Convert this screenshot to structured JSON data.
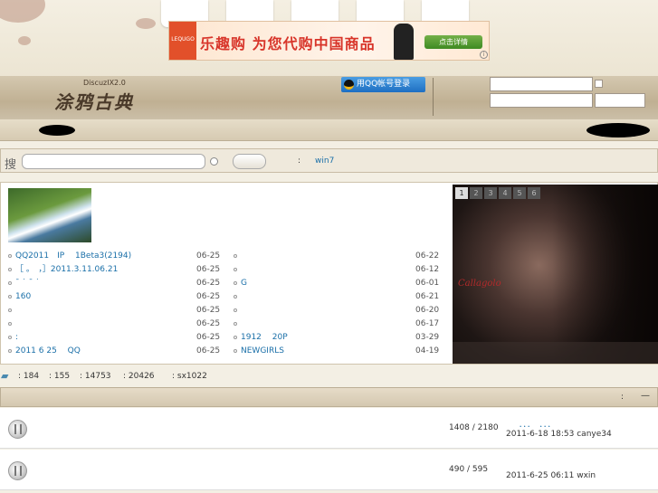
{
  "header": {
    "banner": {
      "brand_small": "LEQUGO",
      "slogan": "乐趣购 为您代购中国商品",
      "cta": "点击详情",
      "info": "i"
    },
    "site_logo": "涂鸦古典",
    "version": "DiscuzIX2.0",
    "qq_login": "用QQ帐号登录"
  },
  "search": {
    "icon": "搜",
    "colon": ":",
    "hot_term": "win7"
  },
  "list": {
    "left": [
      {
        "title": "QQ2011　IP　 1Beta3(2194)",
        "date": "06-25"
      },
      {
        "title": "［ 。　，］2011.3.11.06.21",
        "date": "06-25"
      },
      {
        "title": "ˉ ˙ ˉ ˙",
        "date": "06-25"
      },
      {
        "title": "160",
        "date": "06-25"
      },
      {
        "title": "",
        "date": "06-25"
      },
      {
        "title": "",
        "date": "06-25"
      },
      {
        "title": ":",
        "date": "06-25"
      },
      {
        "title": "2011 6 25　 QQ",
        "date": "06-25"
      }
    ],
    "right": [
      {
        "title": "",
        "date": "06-22"
      },
      {
        "title": "",
        "date": "06-12"
      },
      {
        "title": "G",
        "date": "06-01"
      },
      {
        "title": "",
        "date": "06-21"
      },
      {
        "title": "",
        "date": "06-20"
      },
      {
        "title": "",
        "date": "06-17"
      },
      {
        "title": "1912　 20P",
        "date": "03-29"
      },
      {
        "title": "NEWGIRLS",
        "date": "04-19"
      }
    ]
  },
  "slideshow": {
    "numbers": [
      "1",
      "2",
      "3",
      "4",
      "5",
      "6"
    ],
    "active": 0,
    "signature": "Callagolo"
  },
  "stats": {
    "today": ": 184",
    "yesterday": ": 155",
    "posts": ": 14753",
    "members": ": 20426",
    "newest": ": sx1022"
  },
  "forum": {
    "head_colon": ":",
    "collapse": "—",
    "rows": [
      {
        "counts": "1408 / 2180",
        "last_title": "．．．　．．．",
        "last_post": "2011-6-18 18:53 canye34"
      },
      {
        "counts": "490 / 595",
        "last_title": "",
        "last_post": "2011-6-25 06:11 wxin"
      }
    ]
  }
}
